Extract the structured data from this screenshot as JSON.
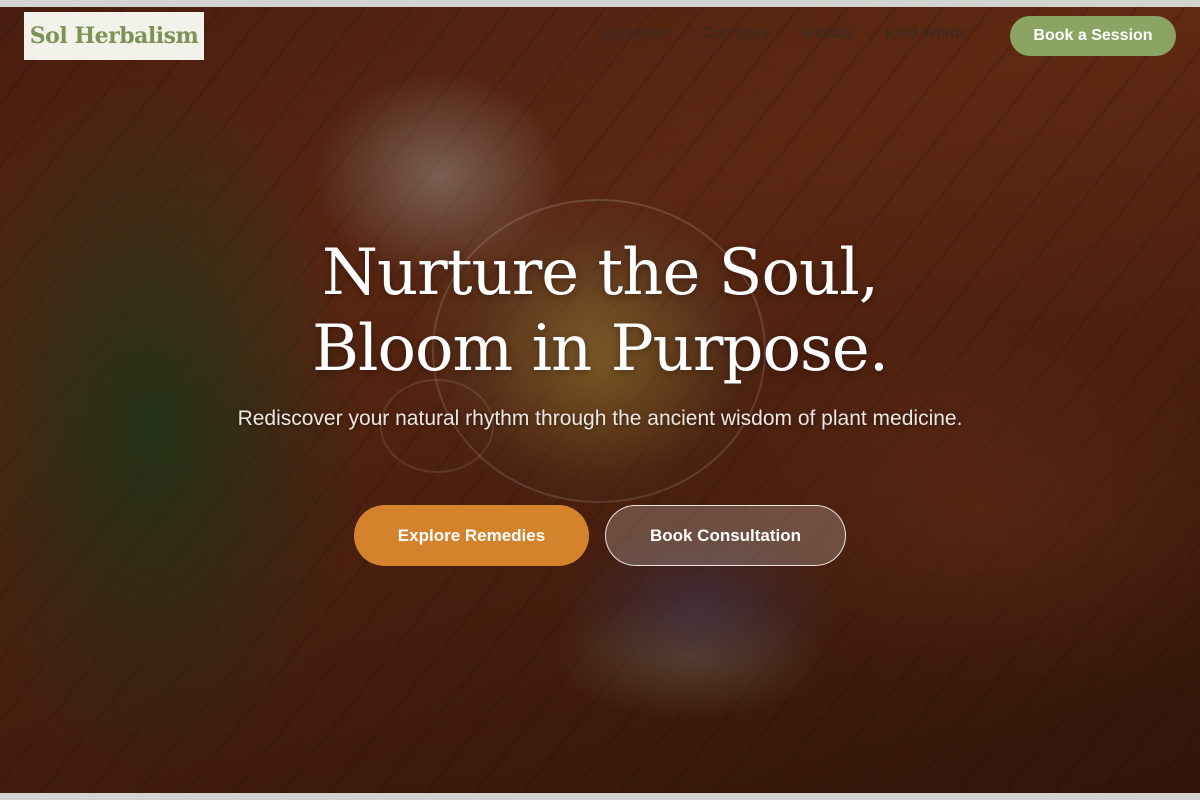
{
  "brand": {
    "logo_text": "Sol Herbalism"
  },
  "nav": {
    "links": [
      "Expertise",
      "Our Story",
      "Rituals",
      "Kind Words"
    ],
    "cta_label": "Book a Session"
  },
  "hero": {
    "title_line1": "Nurture the Soul,",
    "title_line2": "Bloom in Purpose.",
    "subtitle": "Rediscover your natural rhythm through the ancient wisdom of plant medicine.",
    "primary_button": "Explore Remedies",
    "secondary_button": "Book Consultation"
  },
  "colors": {
    "accent_green": "#8ba463",
    "accent_orange": "#d5822c",
    "logo_text": "#7c9256"
  }
}
